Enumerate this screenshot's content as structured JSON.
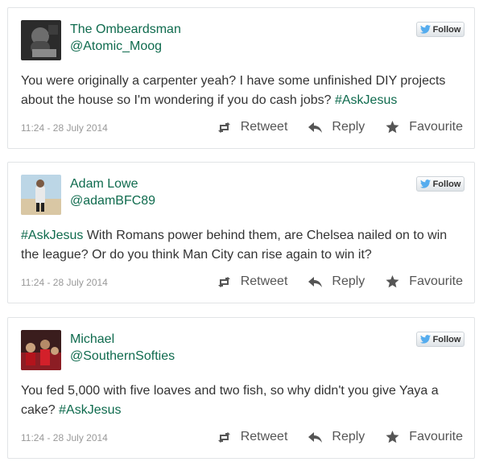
{
  "tweets": [
    {
      "name": "The Ombeardsman",
      "handle": "@Atomic_Moog",
      "follow_label": "Follow",
      "text": "You were originally a carpenter yeah? I have some unfinished DIY projects about the house so I'm wondering if you do cash jobs? ",
      "text_prefix": "",
      "hashtag": "#AskJesus",
      "time": "11:24 - 28 July 2014",
      "retweet_label": "Retweet",
      "reply_label": "Reply",
      "favourite_label": "Favourite"
    },
    {
      "name": "Adam Lowe",
      "handle": "@adamBFC89",
      "follow_label": "Follow",
      "text_prefix": "",
      "hashtag": "#AskJesus",
      "text": " With Romans power behind them, are Chelsea nailed on to win the league? Or do you think Man City can rise again to win it?",
      "time": "11:24 - 28 July 2014",
      "retweet_label": "Retweet",
      "reply_label": "Reply",
      "favourite_label": "Favourite"
    },
    {
      "name": "Michael",
      "handle": "@SouthernSofties",
      "follow_label": "Follow",
      "text": "You fed 5,000 with five loaves and two fish, so why didn't you give Yaya a cake? ",
      "text_prefix": "",
      "hashtag": "#AskJesus",
      "time": "11:24 - 28 July 2014",
      "retweet_label": "Retweet",
      "reply_label": "Reply",
      "favourite_label": "Favourite"
    }
  ],
  "icons": {
    "follow": "twitter-bird-icon",
    "retweet": "retweet-icon",
    "reply": "reply-icon",
    "favourite": "star-icon"
  },
  "colors": {
    "link": "#0f6b4e",
    "text": "#333333",
    "meta": "#999999",
    "twitter_blue": "#55acee"
  }
}
